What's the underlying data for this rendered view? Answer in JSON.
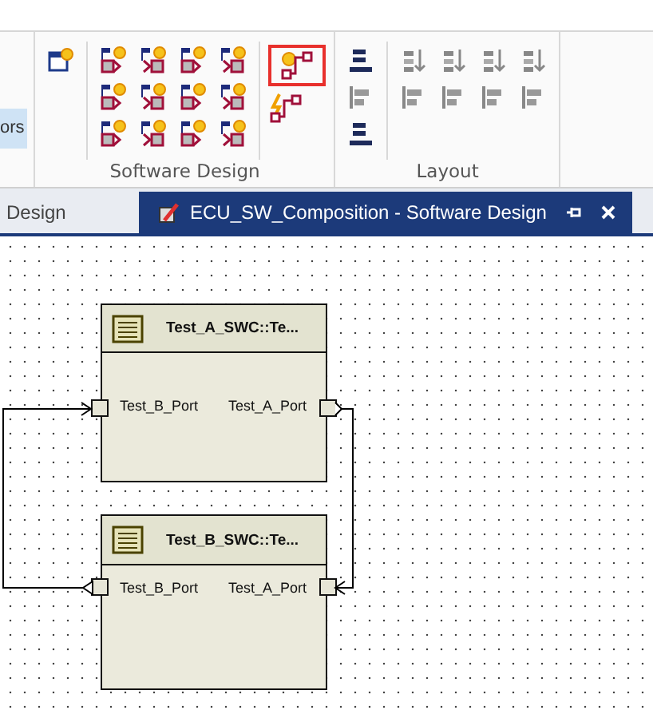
{
  "ribbon": {
    "left_button": {
      "label": "ors"
    },
    "groups": [
      {
        "label": "Software Design",
        "columns": [
          {
            "tools": [
              {
                "kind": "prototype",
                "highlighted": false
              }
            ]
          },
          {
            "tools": [
              {
                "kind": "port-out",
                "highlighted": false
              },
              {
                "kind": "port-in",
                "highlighted": false
              },
              {
                "kind": "port-out",
                "highlighted": false
              },
              {
                "kind": "port-in",
                "highlighted": false
              },
              {
                "kind": "port-out",
                "highlighted": false
              },
              {
                "kind": "port-in",
                "highlighted": false
              },
              {
                "kind": "port-out",
                "highlighted": false
              },
              {
                "kind": "port-in",
                "highlighted": false
              },
              {
                "kind": "port-out",
                "highlighted": false
              },
              {
                "kind": "port-in",
                "highlighted": false
              },
              {
                "kind": "port-out",
                "highlighted": false
              },
              {
                "kind": "port-in",
                "highlighted": false
              }
            ]
          },
          {
            "tools": [
              {
                "kind": "connector",
                "highlighted": true
              },
              {
                "kind": "delegation",
                "highlighted": false
              }
            ]
          }
        ]
      },
      {
        "label": "Layout",
        "columns": [
          {
            "tools": [
              {
                "kind": "auto-layout",
                "highlighted": false
              },
              {
                "kind": "align",
                "highlighted": false
              },
              {
                "kind": "auto-layout",
                "highlighted": false
              }
            ]
          },
          {
            "tools": [
              {
                "kind": "sort",
                "highlighted": false
              },
              {
                "kind": "sort",
                "highlighted": false
              },
              {
                "kind": "sort",
                "highlighted": false
              },
              {
                "kind": "sort",
                "highlighted": false
              },
              {
                "kind": "align",
                "highlighted": false
              },
              {
                "kind": "align",
                "highlighted": false
              },
              {
                "kind": "align",
                "highlighted": false
              },
              {
                "kind": "align",
                "highlighted": false
              }
            ]
          }
        ]
      }
    ]
  },
  "tabs": [
    {
      "label": "Design",
      "selected": false
    },
    {
      "label": "ECU_SW_Composition - Software Design",
      "selected": true
    }
  ],
  "diagram": {
    "components": [
      {
        "title": "Test_A_SWC::Te...",
        "ports": [
          {
            "label": "Test_B_Port"
          },
          {
            "label": "Test_A_Port"
          }
        ]
      },
      {
        "title": "Test_B_SWC::Te...",
        "ports": [
          {
            "label": "Test_B_Port"
          },
          {
            "label": "Test_A_Port"
          }
        ]
      }
    ]
  }
}
